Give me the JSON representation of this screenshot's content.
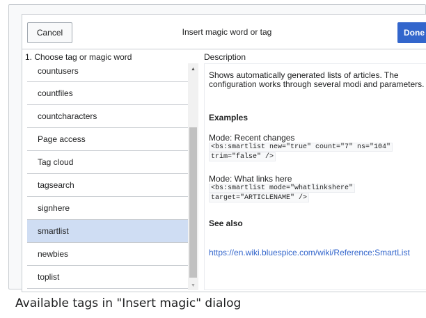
{
  "dialog": {
    "title": "Insert magic word or tag",
    "cancel_label": "Cancel",
    "done_label": "Done"
  },
  "left_panel": {
    "heading": "1. Choose tag or magic word",
    "items": [
      {
        "label": "countusers"
      },
      {
        "label": "countfiles"
      },
      {
        "label": "countcharacters"
      },
      {
        "label": "Page access"
      },
      {
        "label": "Tag cloud"
      },
      {
        "label": "tagsearch"
      },
      {
        "label": "signhere"
      },
      {
        "label": "smartlist",
        "selected": true
      },
      {
        "label": "newbies"
      },
      {
        "label": "toplist"
      }
    ]
  },
  "right_panel": {
    "heading": "Description",
    "description": "Shows automatically generated lists of articles. The configuration works through several modi and parameters.",
    "examples_heading": "Examples",
    "example1_mode": "Mode: Recent changes",
    "example1_code_line1": "<bs:smartlist new=\"true\" count=\"7\" ns=\"104\"",
    "example1_code_line2": "trim=\"false\" />",
    "example2_mode": "Mode: What links here",
    "example2_code_line1": "<bs:smartlist mode=\"whatlinkshere\"",
    "example2_code_line2": "target=\"ARTICLENAME\" />",
    "see_also_heading": "See also",
    "see_also_link": "https://en.wiki.bluespice.com/wiki/Reference:SmartList"
  },
  "caption": "Available tags in \"Insert magic\" dialog",
  "colors": {
    "accent": "#3366cc",
    "selected_row": "#cfddf3",
    "border": "#c8ccd1"
  }
}
